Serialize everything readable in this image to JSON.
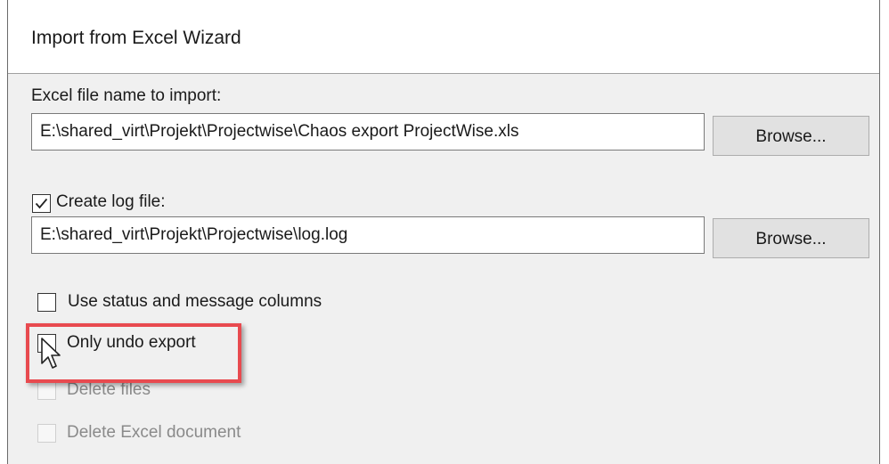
{
  "window": {
    "title": "Import from Excel Wizard"
  },
  "excel_file": {
    "label": "Excel file name to import:",
    "value": "E:\\shared_virt\\Projekt\\Projectwise\\Chaos export ProjectWise.xls",
    "browse_label": "Browse..."
  },
  "log_file": {
    "checkbox_label": "Create log file:",
    "checked": true,
    "value": "E:\\shared_virt\\Projekt\\Projectwise\\log.log",
    "browse_label": "Browse..."
  },
  "options": {
    "use_status": {
      "label": "Use status and message columns",
      "checked": false
    },
    "only_undo": {
      "label": "Only undo export",
      "checked": false
    },
    "delete_files": {
      "label": "Delete files",
      "checked": false,
      "enabled": false
    },
    "delete_excel": {
      "label": "Delete Excel document",
      "checked": false,
      "enabled": false
    }
  },
  "colors": {
    "highlight": "#e84a4f",
    "panel_background": "#f0f0f0"
  },
  "icons": [
    "check-icon",
    "mouse-cursor-icon"
  ]
}
